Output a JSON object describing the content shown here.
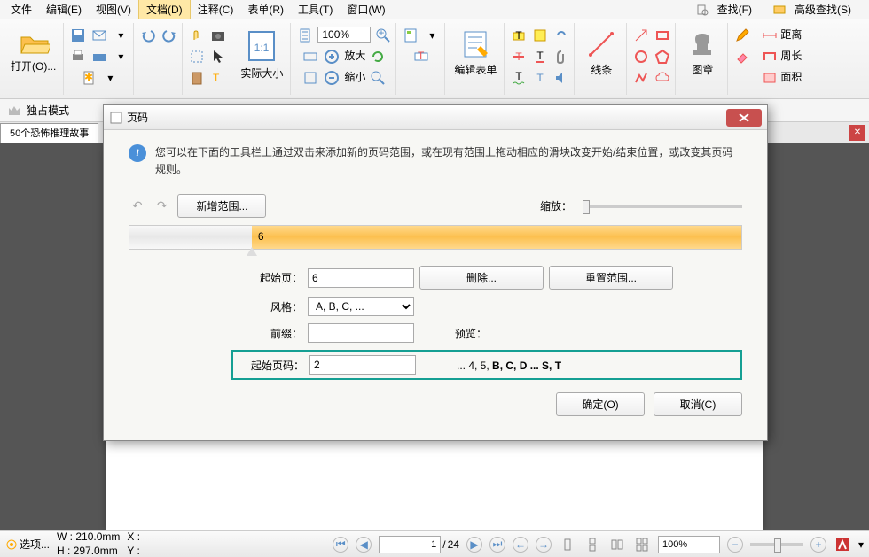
{
  "menu": {
    "file": "文件",
    "edit": "编辑(E)",
    "view": "视图(V)",
    "doc": "文档(D)",
    "comment": "注释(C)",
    "form": "表单(R)",
    "tool": "工具(T)",
    "window": "窗口(W)",
    "find": "查找(F)",
    "advfind": "高级查找(S)"
  },
  "toolbar": {
    "open": "打开(O)...",
    "actual": "实际大小",
    "zoom": "100%",
    "zoomin": "放大",
    "zoomout": "缩小",
    "editform": "编辑表单",
    "lines": "线条",
    "stamp": "图章",
    "distance": "距离",
    "perimeter": "周长",
    "area": "面积"
  },
  "exclusive": "独占模式",
  "tab": "50个恐怖推理故事",
  "dialog": {
    "title": "页码",
    "info": "您可以在下面的工具栏上通过双击来添加新的页码范围，或在现有范围上拖动相应的滑块改变开始/结束位置，或改变其页码规则。",
    "newrange": "新增范围...",
    "zoom": "缩放：",
    "ruler_label": "6",
    "startpage_lbl": "起始页：",
    "startpage": "6",
    "delete": "删除...",
    "reset": "重置范围...",
    "style_lbl": "风格：",
    "style": "A, B, C, ...",
    "prefix_lbl": "前缀：",
    "prefix": "",
    "startnum_lbl": "起始页码：",
    "startnum": "2",
    "preview_lbl": "预览：",
    "preview_pre": "... 4, 5, ",
    "preview_bold": "B, C, D ... S, T",
    "ok": "确定(O)",
    "cancel": "取消(C)"
  },
  "status": {
    "options": "选项...",
    "w": "W :  210.0mm",
    "h": "H :  297.0mm",
    "x": "X :",
    "y": "Y :",
    "page": "1",
    "total": "24",
    "zoom": "100%"
  }
}
